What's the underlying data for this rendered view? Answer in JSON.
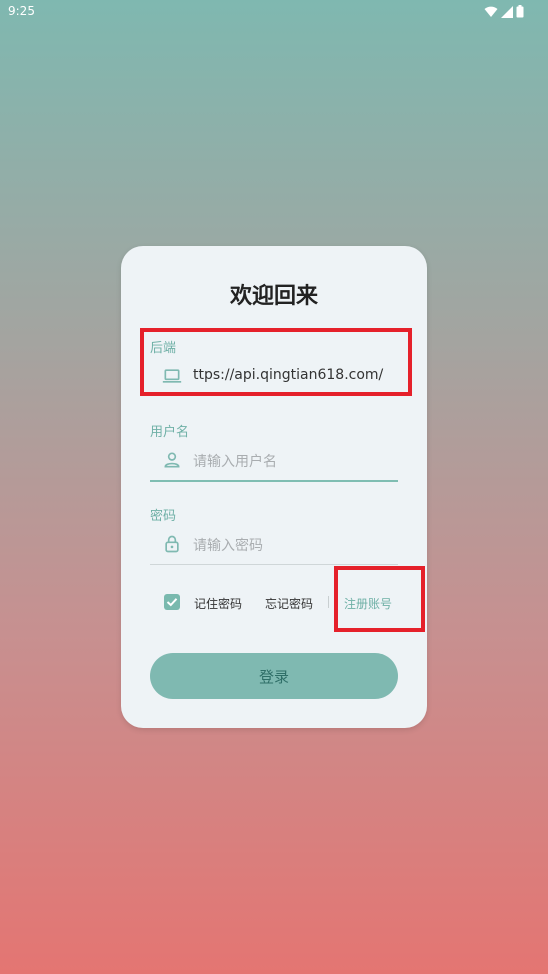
{
  "status_bar": {
    "time": "9:25",
    "icons": [
      "wifi-icon",
      "signal-icon",
      "battery-icon"
    ]
  },
  "card": {
    "title": "欢迎回来",
    "backend": {
      "label": "后端",
      "value": "ttps://api.qingtian618.com/",
      "icon": "laptop-icon"
    },
    "username": {
      "label": "用户名",
      "placeholder": "请输入用户名",
      "icon": "person-icon"
    },
    "password": {
      "label": "密码",
      "placeholder": "请输入密码",
      "icon": "lock-icon"
    },
    "options": {
      "remember": {
        "label": "记住密码",
        "checked": true
      },
      "forgot": "忘记密码",
      "register": "注册账号"
    },
    "login_button": "登录"
  },
  "colors": {
    "accent": "#7fb9b1",
    "label": "#6fb0a6",
    "highlight": "#e5202a"
  }
}
